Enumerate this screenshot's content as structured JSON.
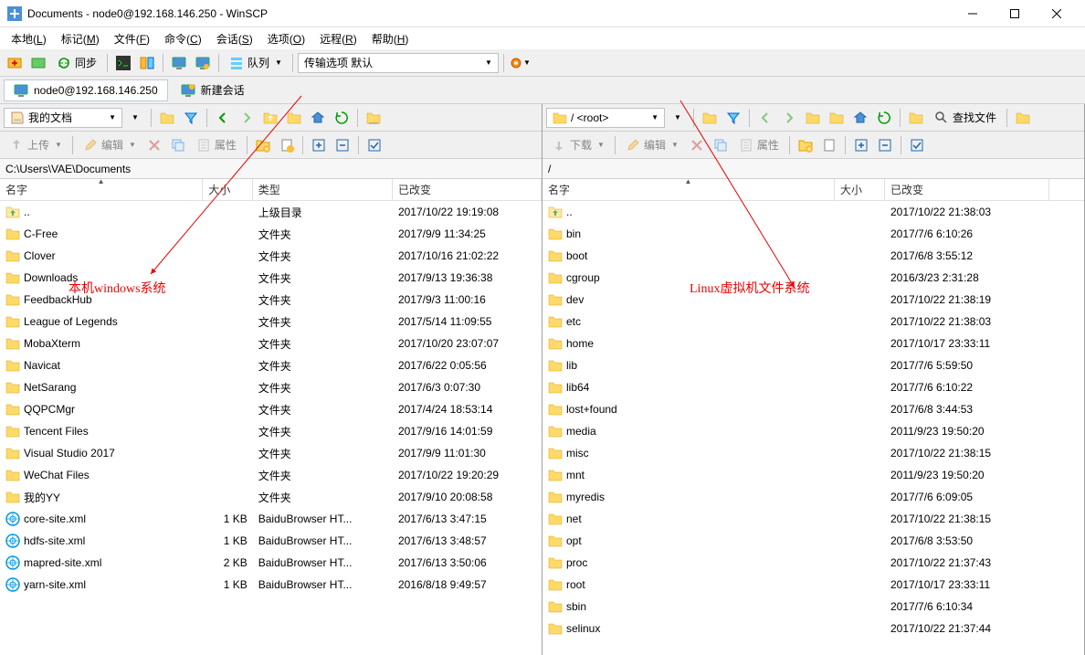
{
  "window": {
    "title": "Documents - node0@192.168.146.250 - WinSCP"
  },
  "menubar": [
    "本地(L)",
    "标记(M)",
    "文件(F)",
    "命令(C)",
    "会话(S)",
    "选项(O)",
    "远程(R)",
    "帮助(H)"
  ],
  "toolbar": {
    "sync_label": "同步",
    "queue_label": "队列",
    "transfer_label": "传输选项 默认"
  },
  "session": {
    "active_tab": "node0@192.168.146.250",
    "new_session": "新建会话"
  },
  "left_panel": {
    "path_label": "我的文档",
    "upload_label": "上传",
    "edit_label": "编辑",
    "properties_label": "属性",
    "breadcrumb": "C:\\Users\\VAE\\Documents",
    "columns": {
      "name": "名字",
      "size": "大小",
      "type": "类型",
      "modified": "已改变"
    },
    "rows": [
      {
        "icon": "up",
        "name": "..",
        "size": "",
        "type": "上级目录",
        "modified": "2017/10/22 19:19:08"
      },
      {
        "icon": "folder",
        "name": "C-Free",
        "size": "",
        "type": "文件夹",
        "modified": "2017/9/9 11:34:25"
      },
      {
        "icon": "folder",
        "name": "Clover",
        "size": "",
        "type": "文件夹",
        "modified": "2017/10/16 21:02:22"
      },
      {
        "icon": "folder",
        "name": "Downloads",
        "size": "",
        "type": "文件夹",
        "modified": "2017/9/13 19:36:38"
      },
      {
        "icon": "folder",
        "name": "FeedbackHub",
        "size": "",
        "type": "文件夹",
        "modified": "2017/9/3 11:00:16"
      },
      {
        "icon": "folder",
        "name": "League of Legends",
        "size": "",
        "type": "文件夹",
        "modified": "2017/5/14 11:09:55"
      },
      {
        "icon": "folder",
        "name": "MobaXterm",
        "size": "",
        "type": "文件夹",
        "modified": "2017/10/20 23:07:07"
      },
      {
        "icon": "folder",
        "name": "Navicat",
        "size": "",
        "type": "文件夹",
        "modified": "2017/6/22 0:05:56"
      },
      {
        "icon": "folder",
        "name": "NetSarang",
        "size": "",
        "type": "文件夹",
        "modified": "2017/6/3 0:07:30"
      },
      {
        "icon": "folder",
        "name": "QQPCMgr",
        "size": "",
        "type": "文件夹",
        "modified": "2017/4/24 18:53:14"
      },
      {
        "icon": "folder",
        "name": "Tencent Files",
        "size": "",
        "type": "文件夹",
        "modified": "2017/9/16 14:01:59"
      },
      {
        "icon": "folder",
        "name": "Visual Studio 2017",
        "size": "",
        "type": "文件夹",
        "modified": "2017/9/9 11:01:30"
      },
      {
        "icon": "folder",
        "name": "WeChat Files",
        "size": "",
        "type": "文件夹",
        "modified": "2017/10/22 19:20:29"
      },
      {
        "icon": "folder",
        "name": "我的YY",
        "size": "",
        "type": "文件夹",
        "modified": "2017/9/10 20:08:58"
      },
      {
        "icon": "xml",
        "name": "core-site.xml",
        "size": "1 KB",
        "type": "BaiduBrowser HT...",
        "modified": "2017/6/13 3:47:15"
      },
      {
        "icon": "xml",
        "name": "hdfs-site.xml",
        "size": "1 KB",
        "type": "BaiduBrowser HT...",
        "modified": "2017/6/13 3:48:57"
      },
      {
        "icon": "xml",
        "name": "mapred-site.xml",
        "size": "2 KB",
        "type": "BaiduBrowser HT...",
        "modified": "2017/6/13 3:50:06"
      },
      {
        "icon": "xml",
        "name": "yarn-site.xml",
        "size": "1 KB",
        "type": "BaiduBrowser HT...",
        "modified": "2016/8/18 9:49:57"
      }
    ]
  },
  "right_panel": {
    "path_label": "/ <root>",
    "download_label": "下载",
    "edit_label": "编辑",
    "properties_label": "属性",
    "find_label": "查找文件",
    "breadcrumb": "/",
    "columns": {
      "name": "名字",
      "size": "大小",
      "modified": "已改变"
    },
    "rows": [
      {
        "icon": "up",
        "name": "..",
        "size": "",
        "modified": "2017/10/22 21:38:03"
      },
      {
        "icon": "folder",
        "name": "bin",
        "size": "",
        "modified": "2017/7/6 6:10:26"
      },
      {
        "icon": "folder",
        "name": "boot",
        "size": "",
        "modified": "2017/6/8 3:55:12"
      },
      {
        "icon": "folder",
        "name": "cgroup",
        "size": "",
        "modified": "2016/3/23 2:31:28"
      },
      {
        "icon": "folder",
        "name": "dev",
        "size": "",
        "modified": "2017/10/22 21:38:19"
      },
      {
        "icon": "folder",
        "name": "etc",
        "size": "",
        "modified": "2017/10/22 21:38:03"
      },
      {
        "icon": "folder",
        "name": "home",
        "size": "",
        "modified": "2017/10/17 23:33:11"
      },
      {
        "icon": "folder",
        "name": "lib",
        "size": "",
        "modified": "2017/7/6 5:59:50"
      },
      {
        "icon": "folder",
        "name": "lib64",
        "size": "",
        "modified": "2017/7/6 6:10:22"
      },
      {
        "icon": "folder",
        "name": "lost+found",
        "size": "",
        "modified": "2017/6/8 3:44:53"
      },
      {
        "icon": "folder",
        "name": "media",
        "size": "",
        "modified": "2011/9/23 19:50:20"
      },
      {
        "icon": "folder",
        "name": "misc",
        "size": "",
        "modified": "2017/10/22 21:38:15"
      },
      {
        "icon": "folder",
        "name": "mnt",
        "size": "",
        "modified": "2011/9/23 19:50:20"
      },
      {
        "icon": "folder",
        "name": "myredis",
        "size": "",
        "modified": "2017/7/6 6:09:05"
      },
      {
        "icon": "folder",
        "name": "net",
        "size": "",
        "modified": "2017/10/22 21:38:15"
      },
      {
        "icon": "folder",
        "name": "opt",
        "size": "",
        "modified": "2017/6/8 3:53:50"
      },
      {
        "icon": "folder",
        "name": "proc",
        "size": "",
        "modified": "2017/10/22 21:37:43"
      },
      {
        "icon": "folder",
        "name": "root",
        "size": "",
        "modified": "2017/10/17 23:33:11"
      },
      {
        "icon": "folder",
        "name": "sbin",
        "size": "",
        "modified": "2017/7/6 6:10:34"
      },
      {
        "icon": "folder",
        "name": "selinux",
        "size": "",
        "modified": "2017/10/22 21:37:44"
      }
    ]
  },
  "annotations": {
    "left_text": "本机windows系统",
    "right_text": "Linux虚拟机文件系统"
  }
}
